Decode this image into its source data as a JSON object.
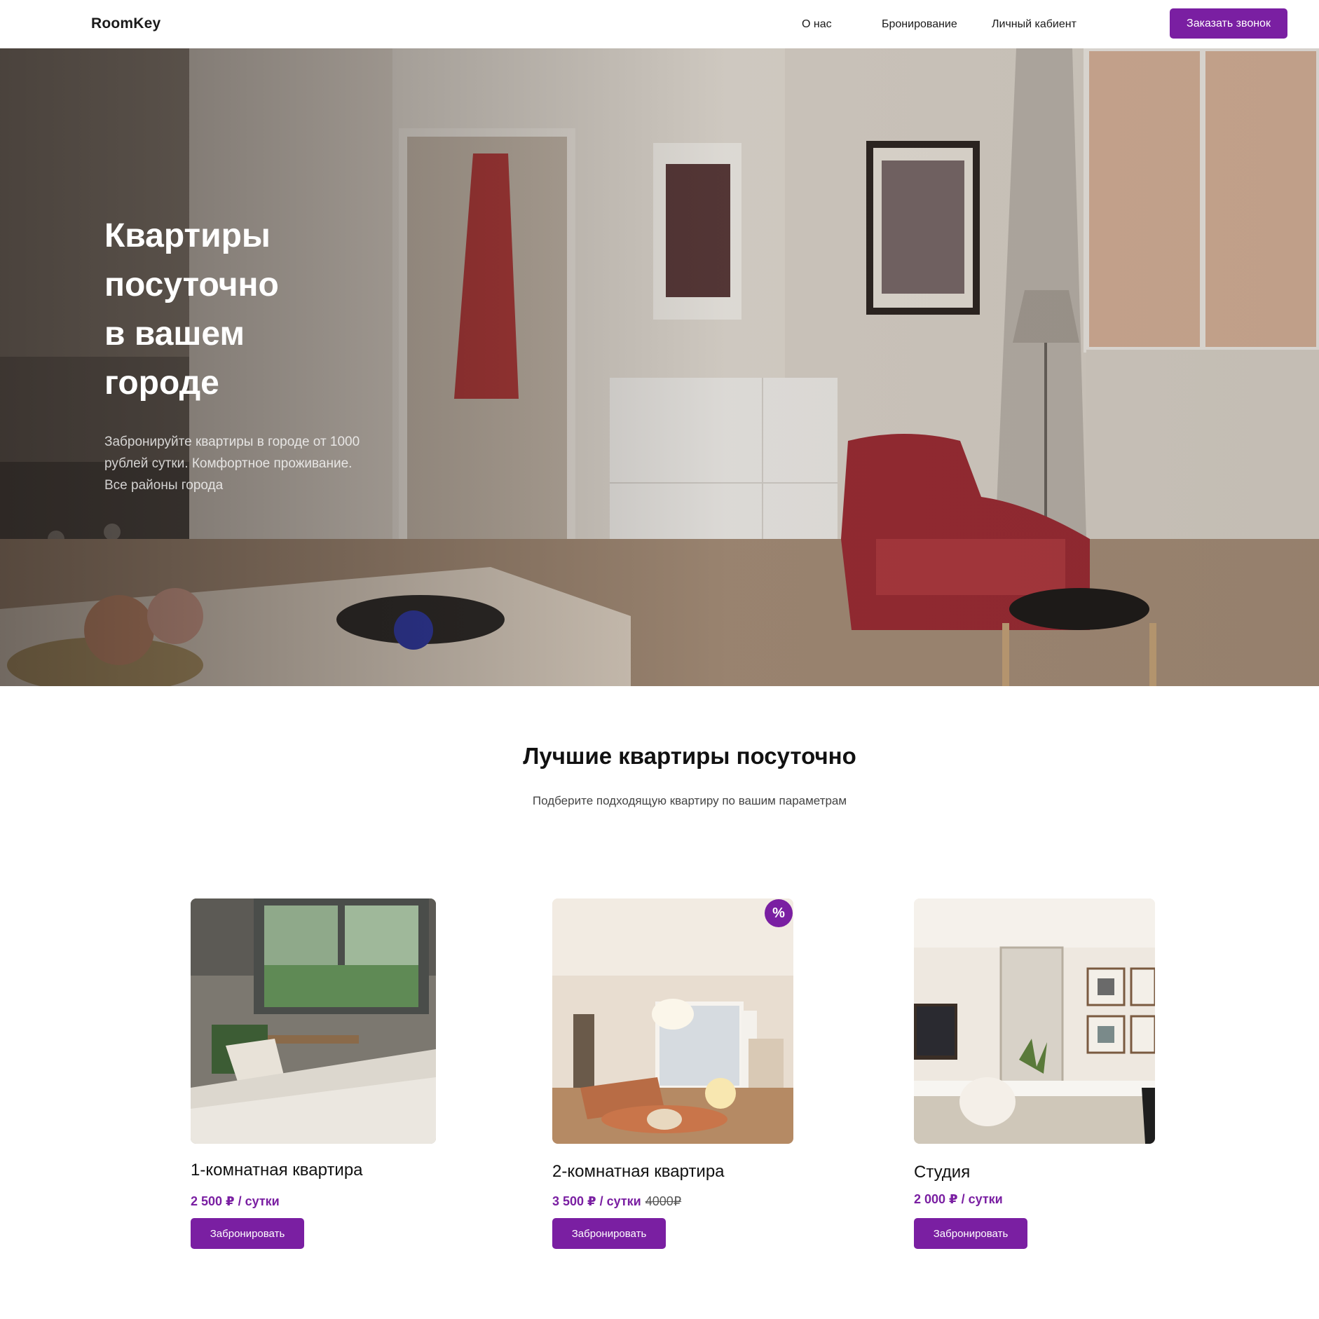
{
  "nav": {
    "logo": "RoomKey",
    "links": [
      "О нас",
      "Бронирование",
      "Личный кабиент"
    ],
    "call_button": "Заказать звонок"
  },
  "hero": {
    "title_lines": [
      "Квартиры",
      "посуточно",
      "в вашем",
      "городе"
    ],
    "subtitle": "Забронируйте квартиры в городе от 1000 рублей сутки. Комфортное проживание. Все районы города"
  },
  "section": {
    "title": "Лучшие квартиры посуточно",
    "subtitle": "Подберите подходящую квартиру по вашим параметрам"
  },
  "cards": [
    {
      "name": "1-комнатная квартира",
      "price": "2 500 ₽ / сутки",
      "old_price": "",
      "button": "Забронировать",
      "badge": ""
    },
    {
      "name": "2-комнатная квартира",
      "price": "3 500 ₽ / сутки",
      "old_price": "4000₽",
      "button": "Забронировать",
      "badge": "%"
    },
    {
      "name": "Студия",
      "price": "2 000 ₽ / сутки",
      "old_price": "",
      "button": "Забронировать",
      "badge": ""
    }
  ],
  "colors": {
    "accent": "#7a1fa2",
    "text": "#111111"
  }
}
